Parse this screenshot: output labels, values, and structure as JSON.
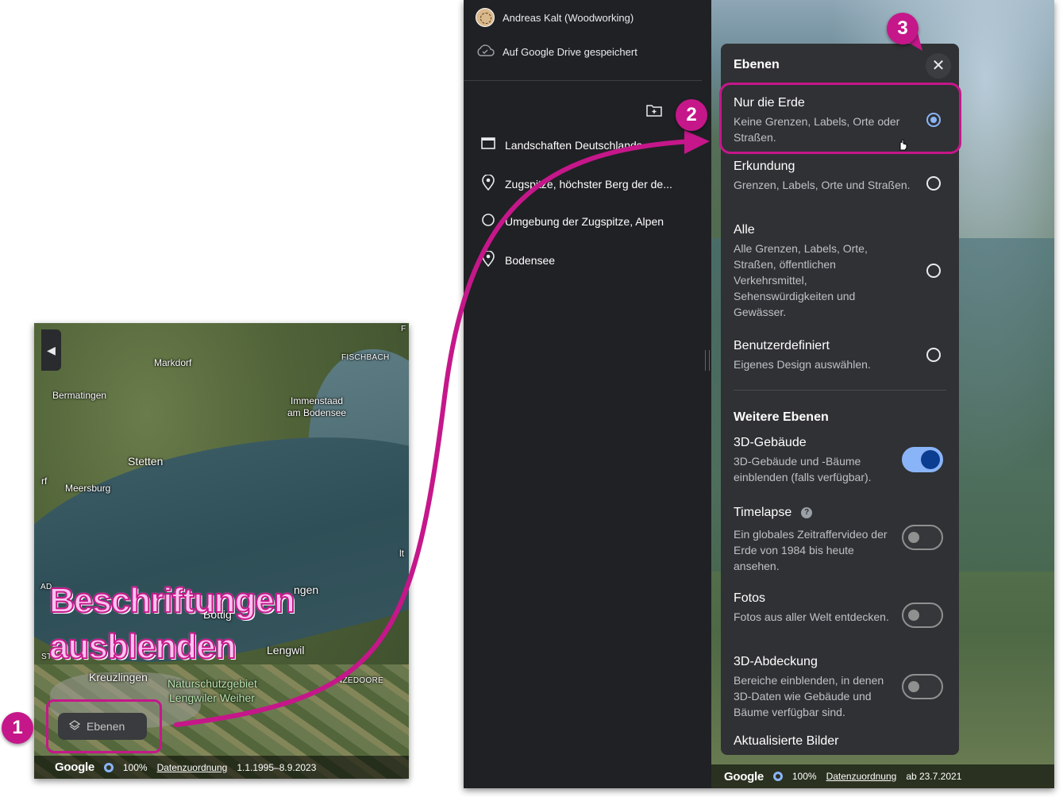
{
  "inset": {
    "labels": {
      "markdorf": "Markdorf",
      "fischbach": "FISCHBACH",
      "bermatingen": "Bermatingen",
      "immenstaad": "Immenstaad",
      "am_bodensee": "am Bodensee",
      "stetten": "Stetten",
      "meersburg": "Meersburg",
      "rf": "rf",
      "muensterlingen": "ngen",
      "bottighofen": "Bottig",
      "lengwil": "Lengwil",
      "kreuzlingen": "Kreuzlingen",
      "naturschutzgebiet": "Naturschutzgebiet",
      "lengwiler_weiher": "Lengwiler Weiher",
      "zedoore": "NZEDOORE",
      "f": "F",
      "alt": "lt",
      "ad": "AD",
      "st": "ST"
    },
    "overlay_line1": "Beschriftungen",
    "overlay_line2": "ausblenden",
    "layers_button": "Ebenen",
    "footer": {
      "logo": "Google",
      "zoom": "100%",
      "attribution": "Datenzuordnung",
      "date": "1.1.1995–8.9.2023"
    }
  },
  "sidebar": {
    "account": "Andreas Kalt (Woodworking)",
    "saved": "Auf Google Drive gespeichert",
    "items": [
      {
        "label": "Landschaften Deutschlands"
      },
      {
        "label": "Zugspitze, höchster Berg der de..."
      },
      {
        "label": "Umgebung der Zugspitze, Alpen"
      },
      {
        "label": "Bodensee"
      }
    ]
  },
  "panel": {
    "title": "Ebenen",
    "close": "✕",
    "options": [
      {
        "title": "Nur die Erde",
        "desc": "Keine Grenzen, Labels, Orte oder Straßen."
      },
      {
        "title": "Erkundung",
        "desc": "Grenzen, Labels, Orte und Straßen."
      },
      {
        "title": "Alle",
        "desc": "Alle Grenzen, Labels, Orte, Straßen, öffentlichen Verkehrsmittel, Sehenswürdigkeiten und Gewässer."
      },
      {
        "title": "Benutzerdefiniert",
        "desc": "Eigenes Design auswählen."
      }
    ],
    "selected_option": 0,
    "more_title": "Weitere Ebenen",
    "more": [
      {
        "title": "3D-Gebäude",
        "desc": "3D-Gebäude und -Bäume einblenden (falls verfügbar).",
        "enabled": true
      },
      {
        "title": "Timelapse",
        "desc": "Ein globales Zeitraffervideo der Erde von 1984 bis heute ansehen.",
        "enabled": false
      },
      {
        "title": "Fotos",
        "desc": "Fotos aus aller Welt entdecken.",
        "enabled": false
      },
      {
        "title": "3D-Abdeckung",
        "desc": "Bereiche einblenden, in denen 3D-Daten wie Gebäude und Bäume verfügbar sind.",
        "enabled": false
      },
      {
        "title": "Aktualisierte Bilder"
      }
    ]
  },
  "app_footer": {
    "logo": "Google",
    "zoom": "100%",
    "attribution": "Datenzuordnung",
    "date": "ab 23.7.2021"
  },
  "markers": {
    "one": "1",
    "two": "2",
    "three": "3"
  },
  "colors": {
    "accent": "#c5178a",
    "toggle_on": "#8ab4f8",
    "panel_bg": "#303134",
    "app_bg": "#202124"
  }
}
